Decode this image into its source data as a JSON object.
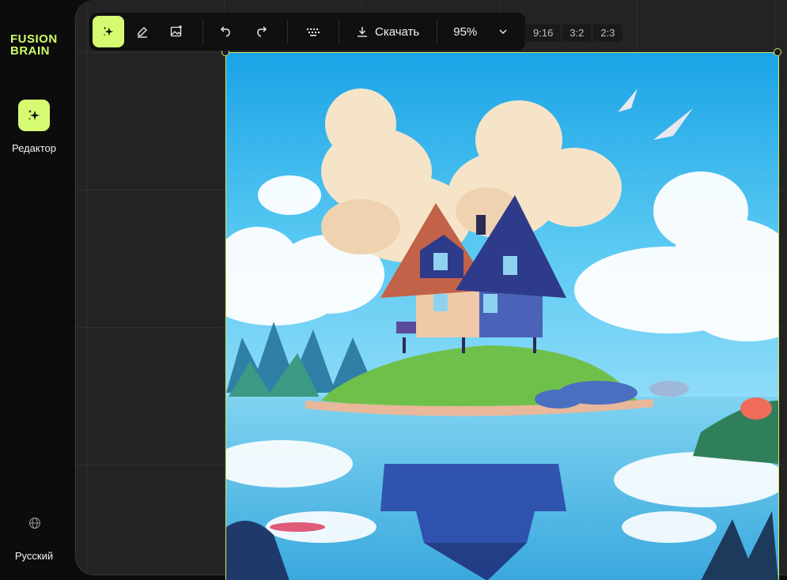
{
  "brand": {
    "line1": "FUSION",
    "line2": "BRAIN",
    "color": "#cffb6a"
  },
  "sidebar": {
    "items": [
      {
        "label": "Редактор",
        "icon": "sparkle-icon",
        "active": true
      }
    ],
    "language": {
      "label": "Русский",
      "icon": "globe-icon"
    }
  },
  "toolbar": {
    "tools": [
      {
        "name": "generate",
        "icon": "sparkle-icon",
        "active": true
      },
      {
        "name": "eraser",
        "icon": "eraser-icon"
      },
      {
        "name": "add-image",
        "icon": "image-plus-icon"
      }
    ],
    "undo_icon": "undo-icon",
    "redo_icon": "redo-icon",
    "keyboard_icon": "keyboard-icon",
    "download_label": "Скачать",
    "zoom": "95%"
  },
  "aspect_ratios": [
    "9:16",
    "3:2",
    "2:3"
  ],
  "canvas": {
    "image": "house-on-island-illustration",
    "accent": "#cbe86b"
  }
}
